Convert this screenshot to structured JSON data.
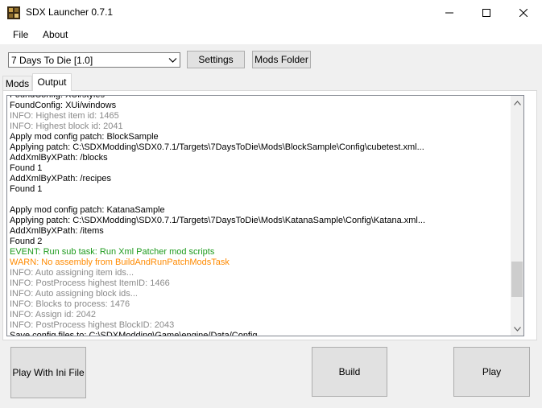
{
  "window": {
    "title": "SDX Launcher 0.7.1"
  },
  "menu": {
    "file": "File",
    "about": "About"
  },
  "toolbar": {
    "game_select_value": "7 Days To Die [1.0]",
    "settings_label": "Settings",
    "mods_folder_label": "Mods Folder"
  },
  "tabs": {
    "mods": "Mods",
    "output": "Output"
  },
  "colors": {
    "default": "#000000",
    "info": "#8a8a8a",
    "event": "#1e9b1e",
    "warn": "#ff8a00"
  },
  "log": {
    "lines": [
      {
        "text": "FoundConfig: XUi/styles",
        "level": "default"
      },
      {
        "text": "FoundConfig: XUi/windows",
        "level": "default"
      },
      {
        "text": "INFO: Highest item id: 1465",
        "level": "info"
      },
      {
        "text": "INFO: Highest block id: 2041",
        "level": "info"
      },
      {
        "text": " Apply mod config patch: BlockSample",
        "level": "default"
      },
      {
        "text": " Applying patch: C:\\SDXModding\\SDX0.7.1/Targets\\7DaysToDie\\Mods\\BlockSample\\Config\\cubetest.xml...",
        "level": "default"
      },
      {
        "text": " AddXmlByXPath: /blocks",
        "level": "default"
      },
      {
        "text": " Found 1",
        "level": "default"
      },
      {
        "text": " AddXmlByXPath: /recipes",
        "level": "default"
      },
      {
        "text": " Found 1",
        "level": "default"
      },
      {
        "text": "",
        "level": "default"
      },
      {
        "text": " Apply mod config patch: KatanaSample",
        "level": "default"
      },
      {
        "text": " Applying patch: C:\\SDXModding\\SDX0.7.1/Targets\\7DaysToDie\\Mods\\KatanaSample\\Config\\Katana.xml...",
        "level": "default"
      },
      {
        "text": " AddXmlByXPath: /items",
        "level": "default"
      },
      {
        "text": " Found 2",
        "level": "default"
      },
      {
        "text": "EVENT: Run sub task: Run Xml Patcher mod scripts",
        "level": "event"
      },
      {
        "text": "WARN: No assembly from BuildAndRunPatchModsTask",
        "level": "warn"
      },
      {
        "text": "INFO: Auto assigning item ids...",
        "level": "info"
      },
      {
        "text": "INFO: PostProcess highest ItemID: 1466",
        "level": "info"
      },
      {
        "text": "INFO: Auto assigning block ids...",
        "level": "info"
      },
      {
        "text": "INFO: Blocks to process: 1476",
        "level": "info"
      },
      {
        "text": "INFO: Assign id: 2042",
        "level": "info"
      },
      {
        "text": "INFO: PostProcess highest BlockID: 2043",
        "level": "info"
      },
      {
        "text": " Save config files to: C:\\SDXModding\\Game\\engine/Data/Config",
        "level": "default"
      }
    ]
  },
  "scroll_position": 0.85,
  "buttons": {
    "play_with_ini": "Play With Ini File",
    "build": "Build",
    "play": "Play"
  }
}
